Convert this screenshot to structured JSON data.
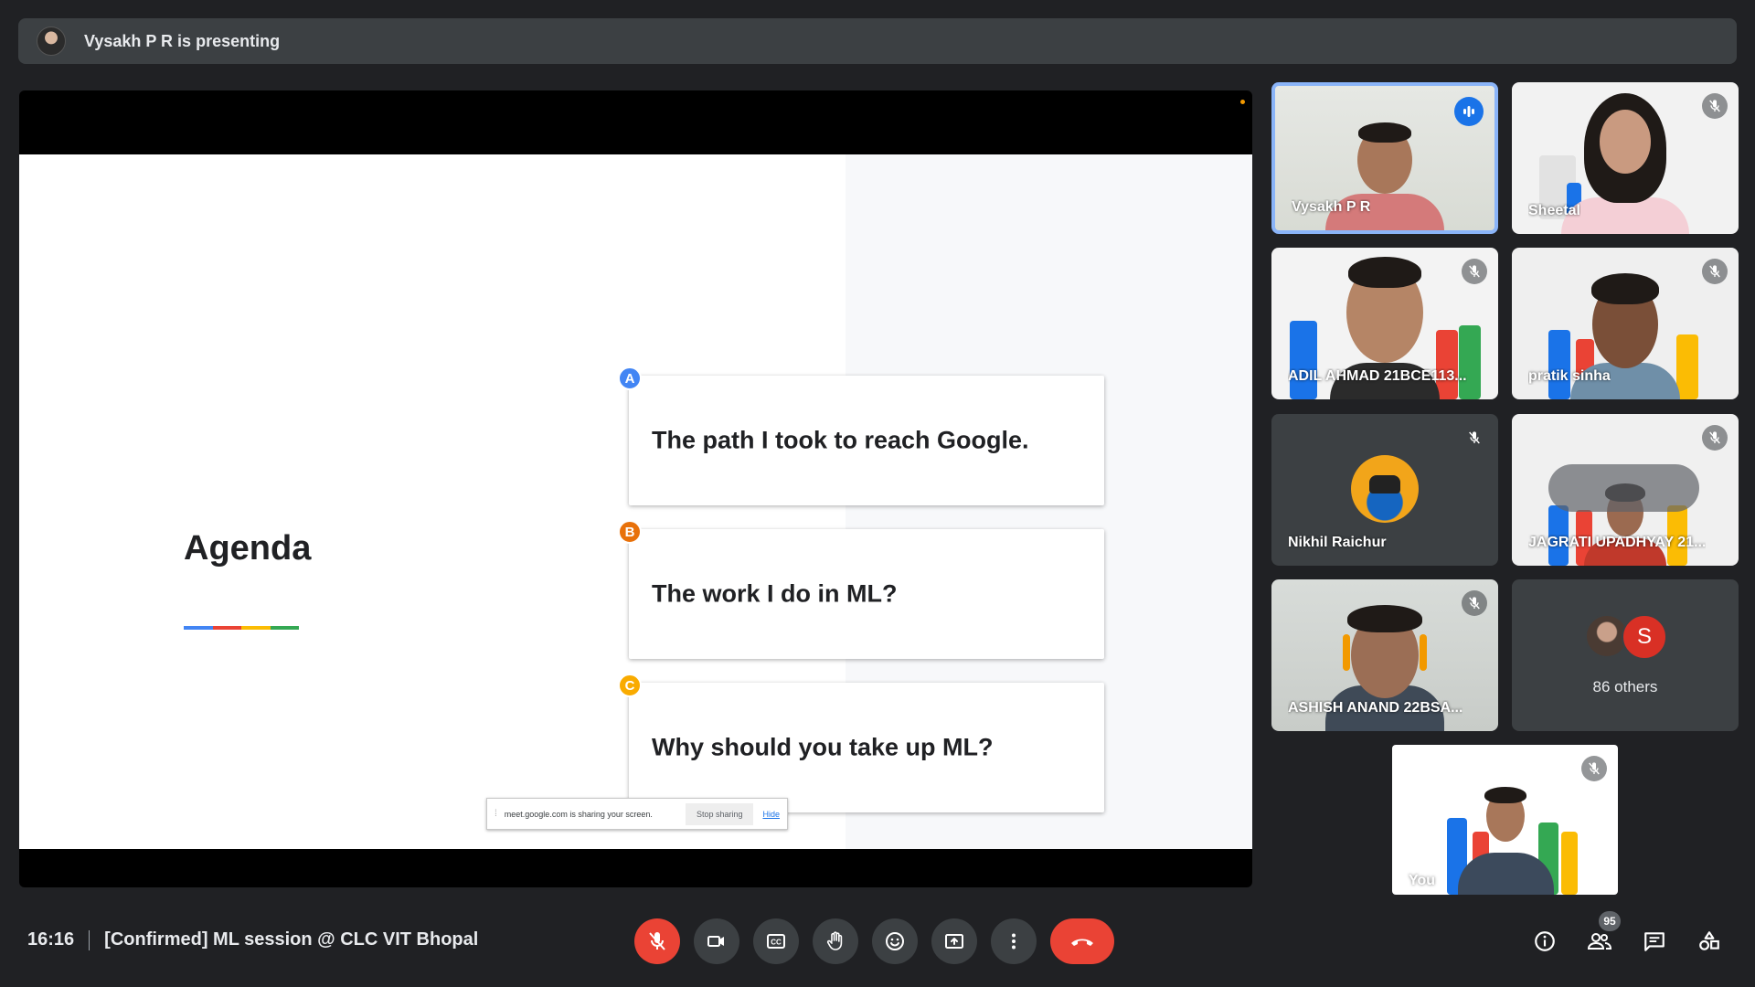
{
  "banner": {
    "text": "Vysakh P R is presenting"
  },
  "slide": {
    "title": "Agenda",
    "items": [
      {
        "badge": "A",
        "text": "The path I took to reach Google.",
        "color": "#4285f4"
      },
      {
        "badge": "B",
        "text": "The work I do in ML?",
        "color": "#e8710a"
      },
      {
        "badge": "C",
        "text": "Why should you take up ML?",
        "color": "#f9ab00"
      }
    ],
    "underline_colors": [
      "#4285f4",
      "#ea4335",
      "#fbbc04",
      "#34a853"
    ],
    "share_bar": {
      "message": "meet.google.com is sharing your screen.",
      "stop": "Stop sharing",
      "hide": "Hide"
    }
  },
  "participants": [
    {
      "name": "Vysakh P R",
      "speaking": true
    },
    {
      "name": "Sheetal",
      "muted": true
    },
    {
      "name": "ADIL AHMAD 21BCE113...",
      "muted": true
    },
    {
      "name": "pratik sinha",
      "muted": true
    },
    {
      "name": "Nikhil Raichur",
      "muted": true
    },
    {
      "name": "JAGRATI UPADHYAY 21...",
      "muted": true
    },
    {
      "name": "ASHISH ANAND 22BSA...",
      "muted": true
    }
  ],
  "others": {
    "label": "86 others",
    "avatar_letter": "S"
  },
  "self": {
    "name": "You",
    "muted": true
  },
  "meeting": {
    "time": "16:16",
    "title": "[Confirmed] ML session @ CLC VIT Bhopal"
  },
  "people_count": "95",
  "colors": {
    "accent": "#8ab4f8",
    "danger": "#ea4335",
    "surface": "#3c4043",
    "background": "#202124"
  }
}
